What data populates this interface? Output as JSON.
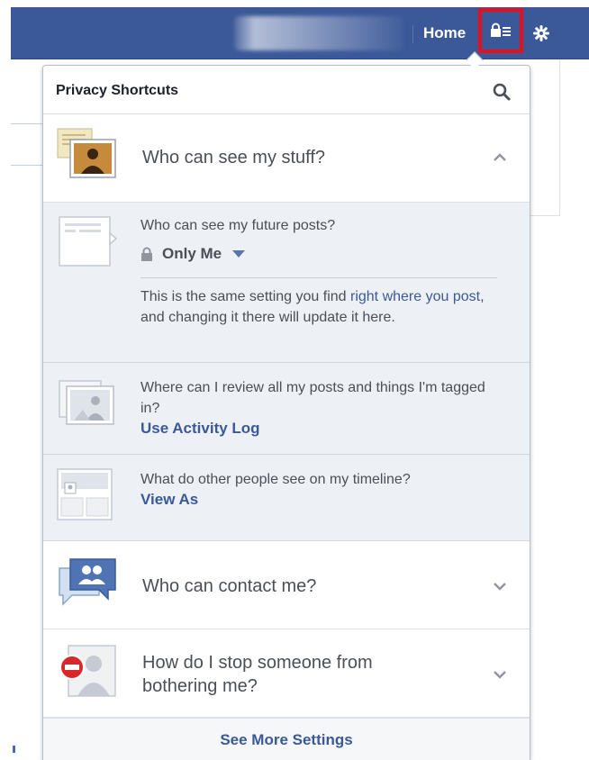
{
  "topbar": {
    "home_label": "Home"
  },
  "panel": {
    "title": "Privacy Shortcuts",
    "sections": {
      "stuff": {
        "label": "Who can see my stuff?",
        "items": {
          "future_posts": {
            "question": "Who can see my future posts?",
            "audience": "Only Me",
            "explanation_before": "This is the same setting you find ",
            "explanation_link": "right where you post",
            "explanation_after": ", and changing it there will update it here."
          },
          "review": {
            "question": "Where can I review all my posts and things I'm tagged in?",
            "link": "Use Activity Log"
          },
          "timeline": {
            "question": "What do other people see on my timeline?",
            "link": "View As"
          }
        }
      },
      "contact": {
        "label": "Who can contact me?"
      },
      "stop": {
        "label": "How do I stop someone from bothering me?"
      }
    },
    "footer_link": "See More Settings"
  },
  "icons": {
    "privacy": "lock-list-icon",
    "settings": "gear-icon",
    "search": "search-icon",
    "stuff": "photo-stack-icon",
    "future_posts": "post-icon",
    "review": "photos-icon",
    "timeline": "timeline-icon",
    "contact": "people-chat-icon",
    "stop": "block-person-icon",
    "lock": "lock-icon",
    "chevron_up": "chevron-up-icon",
    "chevron_down": "chevron-down-icon"
  },
  "colors": {
    "brand": "#3b5998",
    "highlight_box": "#e8101a",
    "sub_background": "#edf0f5",
    "link": "#3b5998",
    "text": "#4b4f56"
  }
}
